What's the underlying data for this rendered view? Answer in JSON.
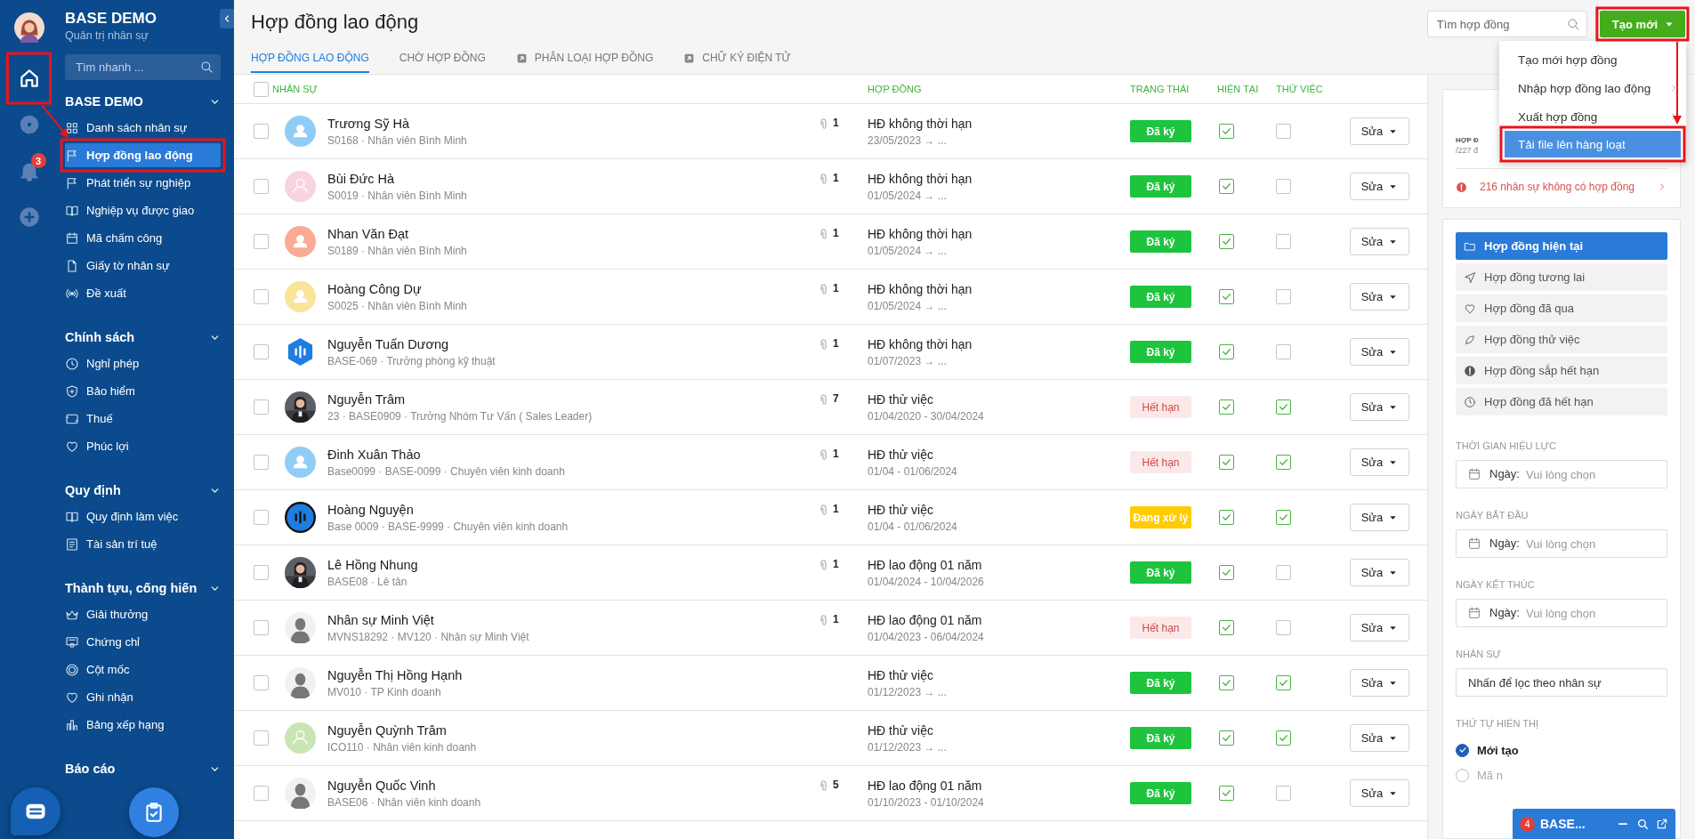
{
  "rail": {
    "items": [
      {
        "selected": true,
        "annotated": true
      },
      {
        "selected": false
      },
      {
        "selected": false,
        "badge": "3"
      },
      {
        "selected": false
      }
    ]
  },
  "sidebar": {
    "title": "BASE DEMO",
    "subtitle": "Quản trị nhân sự",
    "search": {
      "placeholder": "Tìm nhanh ..."
    },
    "sections": [
      {
        "title": "BASE DEMO",
        "expanded": true,
        "items": [
          {
            "label": "Danh sách nhân sự",
            "selected": false
          },
          {
            "label": "Hợp đồng lao động",
            "selected": true,
            "annotated": true
          },
          {
            "label": "Phát triển sự nghiệp",
            "selected": false
          },
          {
            "label": "Nghiệp vụ được giao",
            "selected": false
          },
          {
            "label": "Mã chấm công",
            "selected": false
          },
          {
            "label": "Giấy tờ nhân sự",
            "selected": false
          },
          {
            "label": "Đề xuất",
            "selected": false
          }
        ]
      },
      {
        "title": "Chính sách",
        "expanded": true,
        "items": [
          {
            "label": "Nghỉ phép",
            "selected": false
          },
          {
            "label": "Bảo hiểm",
            "selected": false
          },
          {
            "label": "Thuế",
            "selected": false
          },
          {
            "label": "Phúc lợi",
            "selected": false
          }
        ]
      },
      {
        "title": "Quy định",
        "expanded": true,
        "items": [
          {
            "label": "Quy định làm việc",
            "selected": false
          },
          {
            "label": "Tài sản trí tuệ",
            "selected": false
          }
        ]
      },
      {
        "title": "Thành tựu, cống hiến",
        "expanded": true,
        "items": [
          {
            "label": "Giải thưởng",
            "selected": false
          },
          {
            "label": "Chứng chỉ",
            "selected": false
          },
          {
            "label": "Cột mốc",
            "selected": false
          },
          {
            "label": "Ghi nhận",
            "selected": false
          },
          {
            "label": "Bảng xếp hạng",
            "selected": false
          }
        ]
      },
      {
        "title": "Báo cáo",
        "expanded": true
      }
    ]
  },
  "page": {
    "title": "Hợp đồng lao động",
    "tabs": [
      {
        "label": "HỢP ĐỒNG LAO ĐỘNG",
        "selected": true,
        "kind": "plain"
      },
      {
        "label": "CHỜ HỢP ĐỒNG",
        "selected": false,
        "kind": "plain"
      },
      {
        "label": "PHÂN LOẠI HỢP ĐỒNG",
        "selected": false,
        "kind": "link"
      },
      {
        "label": "CHỮ KÝ ĐIỆN TỬ",
        "selected": false,
        "kind": "link"
      }
    ],
    "search": {
      "placeholder": "Tìm hợp đồng"
    },
    "create_button": {
      "label": "Tạo mới",
      "annotated": true
    },
    "create_menu": [
      {
        "label": "Tạo mới hợp đồng",
        "submenu": false,
        "selected": false
      },
      {
        "label": "Nhập hợp đồng lao động",
        "submenu": true,
        "selected": false
      },
      {
        "label": "Xuất hợp đồng",
        "submenu": true,
        "selected": false
      },
      {
        "label": "Tải file lên hàng loạt",
        "submenu": false,
        "selected": true,
        "annotated": true
      }
    ]
  },
  "table": {
    "all_selected": false,
    "columns": [
      "NHÂN SỰ",
      "HỢP ĐỒNG",
      "TRẠNG THÁI",
      "HIỆN TẠI",
      "THỬ VIỆC"
    ],
    "rows": [
      {
        "selected": false,
        "avatar": {
          "kind": "person",
          "color": "#8fcdf7"
        },
        "name": "Trương Sỹ Hà",
        "info": "S0168 · Nhân viên Bình Minh",
        "attachments": "1",
        "contract": "HĐ không thời hạn",
        "dates": "23/05/2023 → ...",
        "status": {
          "label": "Đã ký",
          "kind": "signed"
        },
        "current": true,
        "trial": false,
        "action": "Sửa"
      },
      {
        "selected": false,
        "avatar": {
          "kind": "outline",
          "color": "#f8d3e2"
        },
        "name": "Bùi Đức Hà",
        "info": "S0019 · Nhân viên Bình Minh",
        "attachments": "1",
        "contract": "HĐ không thời hạn",
        "dates": "01/05/2024 → ...",
        "status": {
          "label": "Đã ký",
          "kind": "signed"
        },
        "current": true,
        "trial": false,
        "action": "Sửa"
      },
      {
        "selected": false,
        "avatar": {
          "kind": "person",
          "color": "#fbaa94"
        },
        "name": "Nhan Văn Đạt",
        "info": "S0189 · Nhân viên Bình Minh",
        "attachments": "1",
        "contract": "HĐ không thời hạn",
        "dates": "01/05/2024 → ...",
        "status": {
          "label": "Đã ký",
          "kind": "signed"
        },
        "current": true,
        "trial": false,
        "action": "Sửa"
      },
      {
        "selected": false,
        "avatar": {
          "kind": "person",
          "color": "#f9e59a"
        },
        "name": "Hoàng Công Dự",
        "info": "S0025 · Nhân viên Bình Minh",
        "attachments": "1",
        "contract": "HĐ không thời hạn",
        "dates": "01/05/2024 → ...",
        "status": {
          "label": "Đã ký",
          "kind": "signed"
        },
        "current": true,
        "trial": false,
        "action": "Sửa"
      },
      {
        "selected": false,
        "avatar": {
          "kind": "hexagon",
          "color": "#1f7de0"
        },
        "name": "Nguyễn Tuấn Dương",
        "info": "BASE-069 · Trưởng phòng kỹ thuật",
        "attachments": "1",
        "contract": "HĐ không thời hạn",
        "dates": "01/07/2023 → ...",
        "status": {
          "label": "Đã ký",
          "kind": "signed"
        },
        "current": true,
        "trial": false,
        "action": "Sửa"
      },
      {
        "selected": false,
        "name": "Nguyễn Trâm",
        "info": "23 · BASE0909 · Trưởng Nhóm Tư Vấn ( Sales Leader)",
        "attachments": "7",
        "contract": "HĐ thử việc",
        "dates": "01/04/2020 - 30/04/2024",
        "status": {
          "label": "Hết hạn",
          "kind": "expired"
        },
        "current": true,
        "trial": true,
        "action": "Sửa"
      },
      {
        "selected": false,
        "avatar": {
          "kind": "person",
          "color": "#8fcdf7"
        },
        "name": "Đinh Xuân Thảo",
        "info": "Base0099 · BASE-0099 · Chuyên viên kinh doanh",
        "attachments": "1",
        "contract": "HĐ thử việc",
        "dates": "01/04 - 01/06/2024",
        "status": {
          "label": "Hết hạn",
          "kind": "expired"
        },
        "current": true,
        "trial": true,
        "action": "Sửa"
      },
      {
        "selected": false,
        "avatar": {
          "kind": "round",
          "color": "#1f7de0"
        },
        "name": "Hoàng Nguyện",
        "info": "Base 0009 · BASE-9999 · Chuyên viên kinh doanh",
        "attachments": "1",
        "contract": "HĐ thử việc",
        "dates": "01/04 - 01/06/2024",
        "status": {
          "label": "Đang xử lý",
          "kind": "processing"
        },
        "current": true,
        "trial": true,
        "action": "Sửa"
      },
      {
        "selected": false,
        "name": "Lê Hồng Nhung",
        "info": "BASE08 · Lê tân",
        "attachments": "1",
        "contract": "HĐ lao động 01 năm",
        "dates": "01/04/2024 - 10/04/2026",
        "status": {
          "label": "Đã ký",
          "kind": "signed"
        },
        "current": true,
        "trial": false,
        "action": "Sửa"
      },
      {
        "selected": false,
        "avatar": {
          "kind": "silhouette"
        },
        "name": "Nhân sự Minh Việt",
        "info": "MVNS18292 · MV120 · Nhân sự Minh Việt",
        "attachments": "1",
        "contract": "HĐ lao động 01 năm",
        "dates": "01/04/2023 - 06/04/2024",
        "status": {
          "label": "Hết hạn",
          "kind": "expired"
        },
        "current": true,
        "trial": false,
        "action": "Sửa"
      },
      {
        "selected": false,
        "avatar": {
          "kind": "silhouette"
        },
        "name": "Nguyễn Thị Hồng Hạnh",
        "info": "MV010 · TP Kinh doanh",
        "contract": "HĐ thử việc",
        "dates": "01/12/2023 → ...",
        "status": {
          "label": "Đã ký",
          "kind": "signed"
        },
        "current": true,
        "trial": true,
        "action": "Sửa"
      },
      {
        "selected": false,
        "avatar": {
          "kind": "outline",
          "color": "#c8e6b4"
        },
        "name": "Nguyễn Quỳnh Trâm",
        "info": "ICO110 · Nhân viên kinh doanh",
        "contract": "HĐ thử việc",
        "dates": "01/12/2023 → ...",
        "status": {
          "label": "Đã ký",
          "kind": "signed"
        },
        "current": true,
        "trial": true,
        "action": "Sửa"
      },
      {
        "selected": false,
        "avatar": {
          "kind": "silhouette"
        },
        "name": "Nguyễn Quốc Vinh",
        "info": "BASE06 · Nhân viên kinh doanh",
        "attachments": "5",
        "contract": "HĐ lao động 01 năm",
        "dates": "01/10/2023 - 01/10/2024",
        "status": {
          "label": "Đã ký",
          "kind": "signed"
        },
        "current": true,
        "trial": false,
        "action": "Sửa"
      }
    ]
  },
  "summary": {
    "heading": "HỢP Đ",
    "subheading": "/227 đ",
    "warning": "216 nhân sự không có hợp đồng"
  },
  "filters": {
    "items": [
      {
        "label": "Hợp đồng hiện tại",
        "selected": true
      },
      {
        "label": "Hợp đồng tương lai",
        "selected": false
      },
      {
        "label": "Hợp đồng đã qua",
        "selected": false
      },
      {
        "label": "Hợp đồng thử việc",
        "selected": false
      },
      {
        "label": "Hợp đồng sắp hết hạn",
        "selected": false
      },
      {
        "label": "Hợp đồng đã hết hạn",
        "selected": false
      }
    ],
    "fields": [
      {
        "title": "THỜI GIAN HIỆU LỰC",
        "kind": "date",
        "label": "Ngày:",
        "placeholder": "Vui lòng chọn"
      },
      {
        "title": "NGÀY BẮT ĐẦU",
        "kind": "date",
        "label": "Ngày:",
        "placeholder": "Vui lòng chọn"
      },
      {
        "title": "NGÀY KẾT THÚC",
        "kind": "date",
        "label": "Ngày:",
        "placeholder": "Vui lòng chọn"
      },
      {
        "title": "NHÂN SỰ",
        "kind": "text",
        "placeholder": "Nhấn để lọc theo nhân sự"
      }
    ],
    "order_title": "THỨ TỰ HIỂN THỊ",
    "order": [
      {
        "label": "Mới tạo",
        "selected": true
      },
      {
        "label": "Mã n",
        "selected": false
      }
    ]
  },
  "chat": {
    "badge": "4",
    "title": "BASE..."
  }
}
